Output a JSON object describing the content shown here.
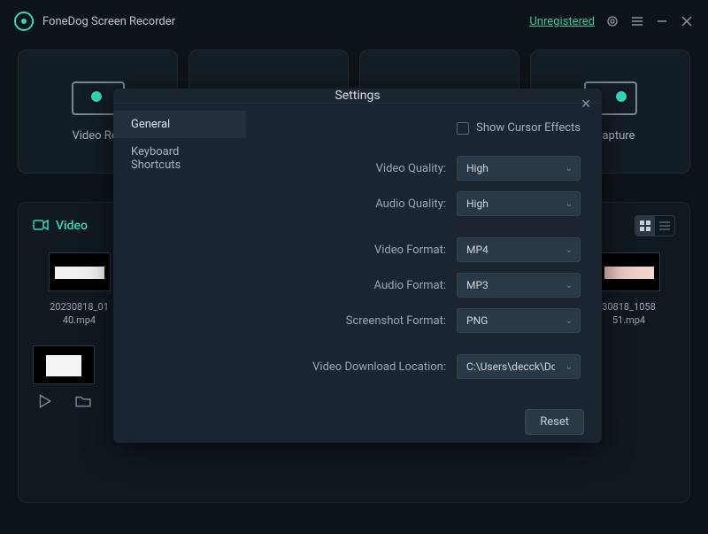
{
  "titlebar": {
    "app_title": "FoneDog Screen Recorder",
    "unregistered": "Unregistered"
  },
  "modes": {
    "video_recorder": "Video Rec",
    "capture": "n Capture"
  },
  "library": {
    "title": "Video",
    "items": [
      {
        "name": "20230818_01\n40.mp4"
      },
      {
        "name": "30818_1058\n51.mp4"
      }
    ]
  },
  "settings": {
    "title": "Settings",
    "tabs": {
      "general": "General",
      "shortcuts": "Keyboard Shortcuts"
    },
    "show_cursor": "Show Cursor Effects",
    "labels": {
      "video_quality": "Video Quality:",
      "audio_quality": "Audio Quality:",
      "video_format": "Video Format:",
      "audio_format": "Audio Format:",
      "screenshot_format": "Screenshot Format:",
      "download_location": "Video Download Location:"
    },
    "values": {
      "video_quality": "High",
      "audio_quality": "High",
      "video_format": "MP4",
      "audio_format": "MP3",
      "screenshot_format": "PNG",
      "download_location": "C:\\Users\\decck\\Do"
    },
    "reset": "Reset"
  }
}
